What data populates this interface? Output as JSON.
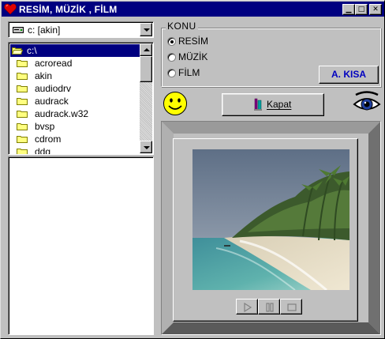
{
  "window": {
    "title": "RESİM, MÜZİK , FİLM",
    "minimize_glyph": "▁",
    "maximize_glyph": "□",
    "close_glyph": "✕"
  },
  "drive": {
    "label": "c: [akin]",
    "icon": "hard-drive-icon"
  },
  "directories": {
    "current": "c:\\",
    "items": [
      "acroread",
      "akin",
      "audiodrv",
      "audrack",
      "audrack.w32",
      "bvsp",
      "cdrom",
      "ddg"
    ]
  },
  "konu": {
    "title": "KONU",
    "options": [
      {
        "label": "RESİM",
        "selected": true
      },
      {
        "label": "MÜZİK",
        "selected": false
      },
      {
        "label": "FİLM",
        "selected": false
      }
    ]
  },
  "author_button": {
    "label": "A. KISA"
  },
  "close_button": {
    "label": "Kapat"
  },
  "icons": {
    "smiley": "smiley-face-icon",
    "eye": "eye-icon",
    "pen": "pen-icon",
    "app": "heart-icon"
  },
  "media_controls": [
    {
      "name": "play",
      "icon": "play-icon"
    },
    {
      "name": "pause",
      "icon": "pause-icon"
    },
    {
      "name": "stop",
      "icon": "stop-icon"
    }
  ],
  "colors": {
    "title_bar": "#000080",
    "face": "#c0c0c0",
    "author_text": "#0000c0",
    "selection": "#000080"
  }
}
